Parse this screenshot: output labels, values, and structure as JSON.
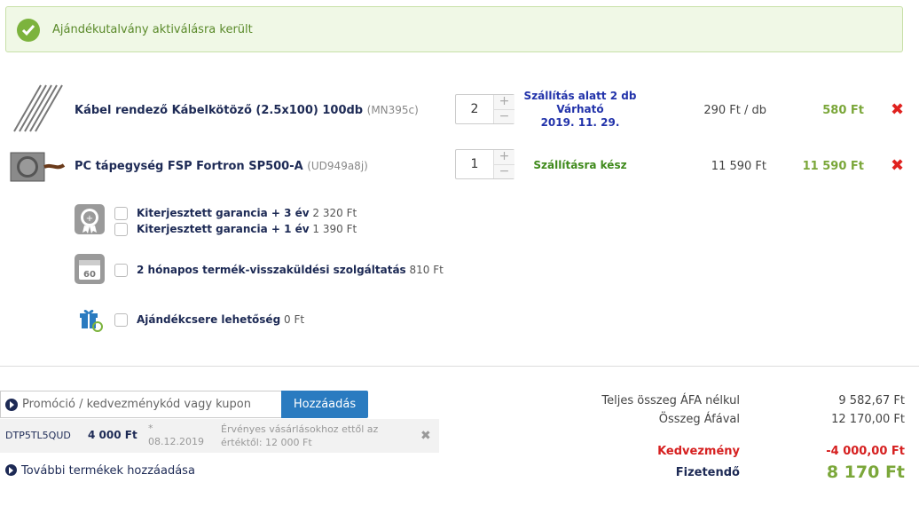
{
  "alert": {
    "message": "Ajándékutalvány aktiválásra került",
    "icon": "check-circle-icon"
  },
  "items": [
    {
      "name": "Kábel rendező Kábelkötöző (2.5x100) 100db",
      "code": "(MN395c)",
      "qty": "2",
      "status_lines": [
        "Szállítás alatt 2 db",
        "Várható",
        "2019. 11. 29."
      ],
      "unit_price": "290 Ft / db",
      "total": "580 Ft"
    },
    {
      "name": "PC tápegység FSP Fortron SP500-A",
      "code": "(UD949a8j)",
      "qty": "1",
      "status_lines": [
        "Szállításra kész"
      ],
      "unit_price": "11 590 Ft",
      "total": "11 590 Ft"
    }
  ],
  "services": {
    "warranty": [
      {
        "label": "Kiterjesztett garancia + 3 év",
        "price": "2 320 Ft"
      },
      {
        "label": "Kiterjesztett garancia + 1 év",
        "price": "1 390 Ft"
      }
    ],
    "return": {
      "label": "2 hónapos termék-visszaküldési szolgáltatás",
      "price": "810 Ft"
    },
    "gift": {
      "label": "Ajándékcsere lehetőség",
      "price": "0 Ft"
    }
  },
  "promo": {
    "placeholder": "Promóció / kedvezménykód vagy kupon",
    "button": "Hozzáadás"
  },
  "coupon": {
    "code": "DTP5TL5QUD",
    "amount": "4 000 Ft",
    "star": "*",
    "date": "08.12.2019",
    "validity": "Érvényes vásárlásokhoz ettől az értéktől: 12 000 Ft",
    "remove": "✖"
  },
  "more_link": "További termékek hozzáadása",
  "summary": {
    "net_label": "Teljes összeg ÁFA nélkul",
    "net_value": "9 582,67 Ft",
    "gross_label": "Összeg Áfával",
    "gross_value": "12 170,00 Ft",
    "discount_label": "Kedvezmény",
    "discount_value": "-4 000,00 Ft",
    "pay_label": "Fizetendő",
    "pay_value": "8 170 Ft"
  },
  "colors": {
    "accent_green": "#7ba73a",
    "remove_red": "#e0221f",
    "button_blue": "#2a7bc0",
    "navy": "#1d2a55"
  }
}
